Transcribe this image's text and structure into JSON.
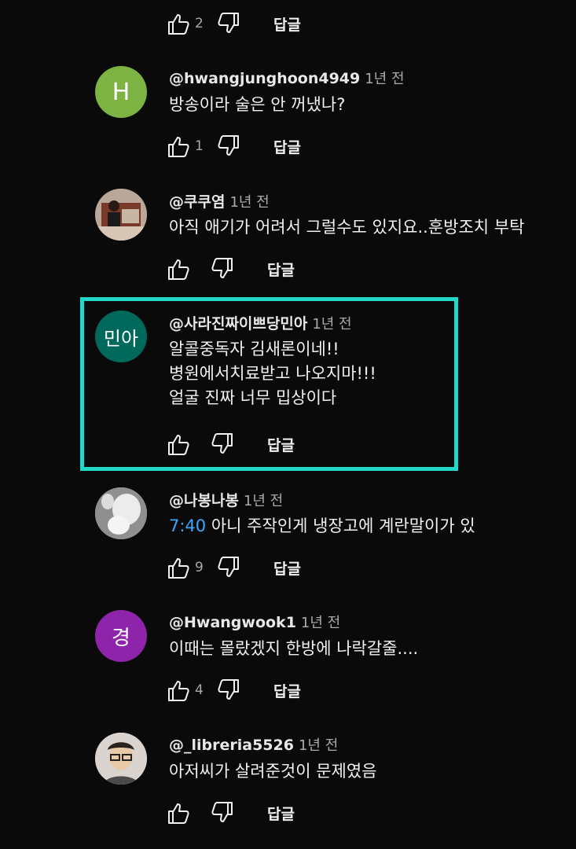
{
  "common": {
    "reply_label": "답글"
  },
  "comments": [
    {
      "author": "",
      "time": "",
      "lines": [],
      "likes": "2"
    },
    {
      "author": "@hwangjunghoon4949",
      "time": "1년 전",
      "lines": [
        "방송이라 술은 안 꺼냈나?"
      ],
      "likes": "1",
      "avatar_text": "H",
      "avatar_color": "#7cb342"
    },
    {
      "author": "@쿠쿠염",
      "time": "1년 전",
      "lines": [
        "아직 애기가 어려서 그럴수도 있지요..훈방조치 부탁"
      ],
      "likes": ""
    },
    {
      "author": "@사라진짜이쁘당민아",
      "time": "1년 전",
      "lines": [
        "알콜중독자 김새론이네!!",
        "병원에서치료받고 나오지마!!!",
        "얼굴 진짜 너무 밉상이다"
      ],
      "likes": "",
      "avatar_text": "민아",
      "avatar_color": "#00695c"
    },
    {
      "author": "@나봉나봉",
      "time": "1년 전",
      "timestamp": "7:40",
      "lines": [
        "아니 주작인게 냉장고에 계란말이가 있"
      ],
      "likes": "9"
    },
    {
      "author": "@Hwangwook1",
      "time": "1년 전",
      "lines": [
        "이때는 몰랐겠지 한방에 나락갈줄...."
      ],
      "likes": "4",
      "avatar_text": "경",
      "avatar_color": "#8e24aa"
    },
    {
      "author": "@_libreria5526",
      "time": "1년 전",
      "lines": [
        "아저씨가 살려준것이 문제였음"
      ],
      "likes": ""
    }
  ],
  "colors": {
    "highlight": "#1fd8c8",
    "link": "#3ea6ff"
  }
}
